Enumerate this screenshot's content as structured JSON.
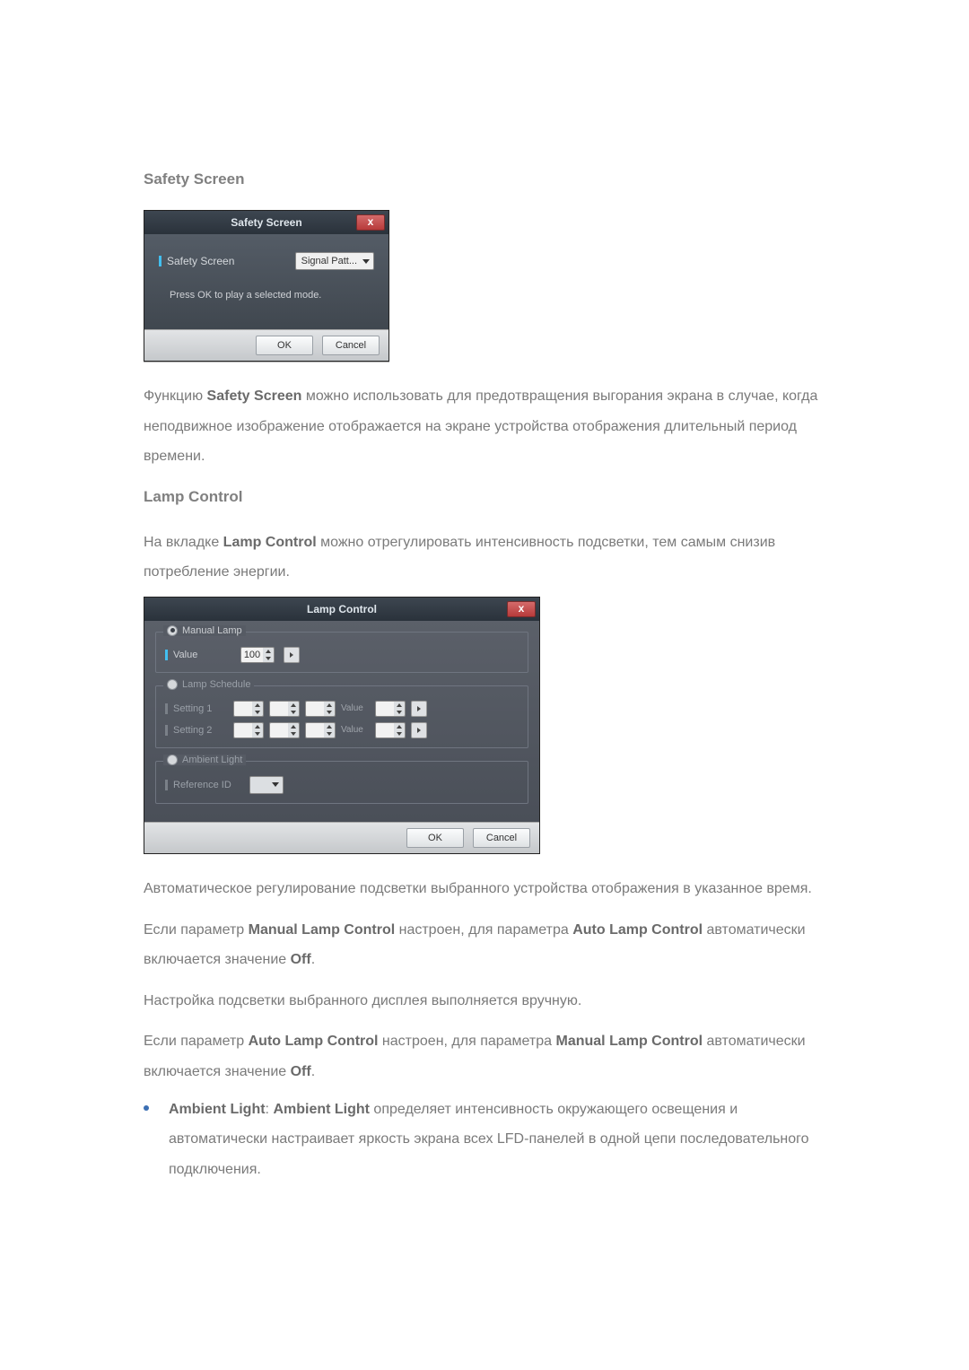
{
  "section1": {
    "title": "Safety Screen",
    "desc_prefix": "Функцию ",
    "desc_bold": "Safety Screen",
    "desc_suffix": " можно использовать для предотвращения выгорания экрана в случае, когда неподвижное изображение отображается на экране устройства отображения длительный период времени."
  },
  "safety_dialog": {
    "title": "Safety Screen",
    "close": "x",
    "field_label": "Safety Screen",
    "select_value": "Signal Patt...",
    "hint": "Press OK to play a selected mode.",
    "ok": "OK",
    "cancel": "Cancel"
  },
  "section2": {
    "title": "Lamp Control",
    "intro_prefix": "На вкладке ",
    "intro_bold": "Lamp Control",
    "intro_suffix": " можно отрегулировать интенсивность подсветки, тем самым снизив потребление энергии."
  },
  "lamp_dialog": {
    "title": "Lamp Control",
    "close": "x",
    "manual": {
      "legend": "Manual Lamp",
      "value_label": "Value",
      "value": "100"
    },
    "schedule": {
      "legend": "Lamp Schedule",
      "row1_label": "Setting 1",
      "row2_label": "Setting 2",
      "value_txt": "Value"
    },
    "ambient": {
      "legend": "Ambient Light",
      "ref_label": "Reference ID"
    },
    "ok": "OK",
    "cancel": "Cancel"
  },
  "para1": "Автоматическое регулирование подсветки выбранного устройства отображения в указанное время.",
  "para2": {
    "p1": "Если параметр ",
    "b1": "Manual Lamp Control",
    "p2": " настроен, для параметра ",
    "b2": "Auto Lamp Control",
    "p3": " автоматически включается значение ",
    "b3": "Off",
    "p4": "."
  },
  "para3": "Настройка подсветки выбранного дисплея выполняется вручную.",
  "para4": {
    "p1": "Если параметр ",
    "b1": "Auto Lamp Control",
    "p2": " настроен, для параметра ",
    "b2": "Manual Lamp Control",
    "p3": " автоматически включается значение ",
    "b3": "Off",
    "p4": "."
  },
  "bullet": {
    "b1": "Ambient Light",
    "colon": ": ",
    "b2": "Ambient Light",
    "rest": " определяет интенсивность окружающего освещения и автоматически настраивает яркость экрана всех LFD-панелей в одной цепи последовательного подключения."
  }
}
